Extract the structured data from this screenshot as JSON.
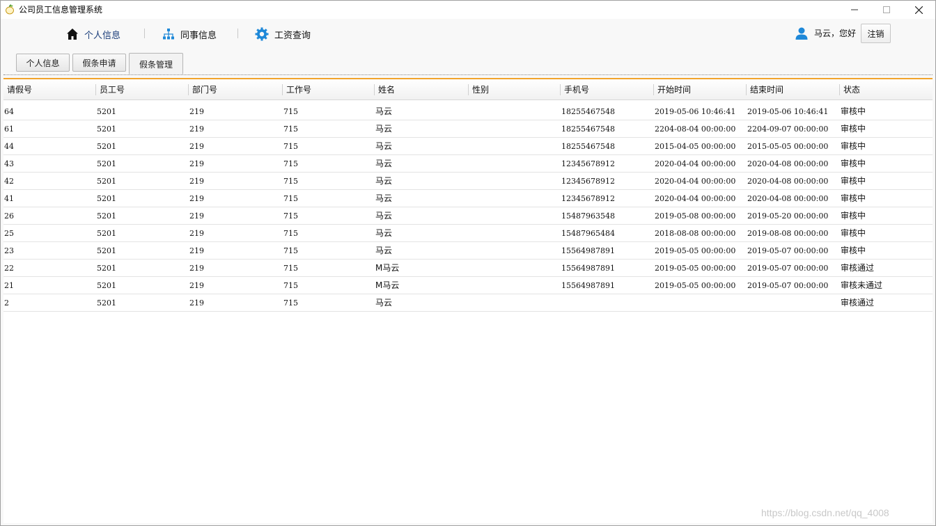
{
  "window": {
    "title": "公司员工信息管理系统"
  },
  "nav": {
    "items": [
      {
        "label": "个人信息",
        "icon": "home-icon"
      },
      {
        "label": "同事信息",
        "icon": "org-chart-icon"
      },
      {
        "label": "工资查询",
        "icon": "gear-icon"
      }
    ]
  },
  "user": {
    "greeting": "马云，您好",
    "logout_label": "注销"
  },
  "tabs": [
    {
      "label": "个人信息",
      "active": false
    },
    {
      "label": "假条申请",
      "active": false
    },
    {
      "label": "假条管理",
      "active": true
    }
  ],
  "table": {
    "columns": [
      "请假号",
      "员工号",
      "部门号",
      "工作号",
      "姓名",
      "性别",
      "手机号",
      "开始时间",
      "结束时间",
      "状态"
    ],
    "rows": [
      [
        "64",
        "5201",
        "219",
        "715",
        "马云",
        "",
        "18255467548",
        "2019-05-06 10:46:41",
        "2019-05-06 10:46:41",
        "审核中"
      ],
      [
        "61",
        "5201",
        "219",
        "715",
        "马云",
        "",
        "18255467548",
        "2204-08-04 00:00:00",
        "2204-09-07 00:00:00",
        "审核中"
      ],
      [
        "44",
        "5201",
        "219",
        "715",
        "马云",
        "",
        "18255467548",
        "2015-04-05 00:00:00",
        "2015-05-05 00:00:00",
        "审核中"
      ],
      [
        "43",
        "5201",
        "219",
        "715",
        "马云",
        "",
        "12345678912",
        "2020-04-04 00:00:00",
        "2020-04-08 00:00:00",
        "审核中"
      ],
      [
        "42",
        "5201",
        "219",
        "715",
        "马云",
        "",
        "12345678912",
        "2020-04-04 00:00:00",
        "2020-04-08 00:00:00",
        "审核中"
      ],
      [
        "41",
        "5201",
        "219",
        "715",
        "马云",
        "",
        "12345678912",
        "2020-04-04 00:00:00",
        "2020-04-08 00:00:00",
        "审核中"
      ],
      [
        "26",
        "5201",
        "219",
        "715",
        "马云",
        "",
        "15487963548",
        "2019-05-08 00:00:00",
        "2019-05-20 00:00:00",
        "审核中"
      ],
      [
        "25",
        "5201",
        "219",
        "715",
        "马云",
        "",
        "15487965484",
        "2018-08-08 00:00:00",
        "2019-08-08 00:00:00",
        "审核中"
      ],
      [
        "23",
        "5201",
        "219",
        "715",
        "马云",
        "",
        "15564987891",
        "2019-05-05 00:00:00",
        "2019-05-07 00:00:00",
        "审核中"
      ],
      [
        "22",
        "5201",
        "219",
        "715",
        "M马云",
        "",
        "15564987891",
        "2019-05-05 00:00:00",
        "2019-05-07 00:00:00",
        "审核通过"
      ],
      [
        "21",
        "5201",
        "219",
        "715",
        "M马云",
        "",
        "15564987891",
        "2019-05-05 00:00:00",
        "2019-05-07 00:00:00",
        "审核未通过"
      ],
      [
        "2",
        "5201",
        "219",
        "715",
        "马云",
        "",
        "",
        "",
        "",
        "审核通过"
      ]
    ]
  },
  "watermark": "https://blog.csdn.net/qq_4008",
  "colors": {
    "accent": "#f2a42c",
    "nav_icon": "#1e88d8",
    "active_nav_text": "#1a3d7a"
  }
}
